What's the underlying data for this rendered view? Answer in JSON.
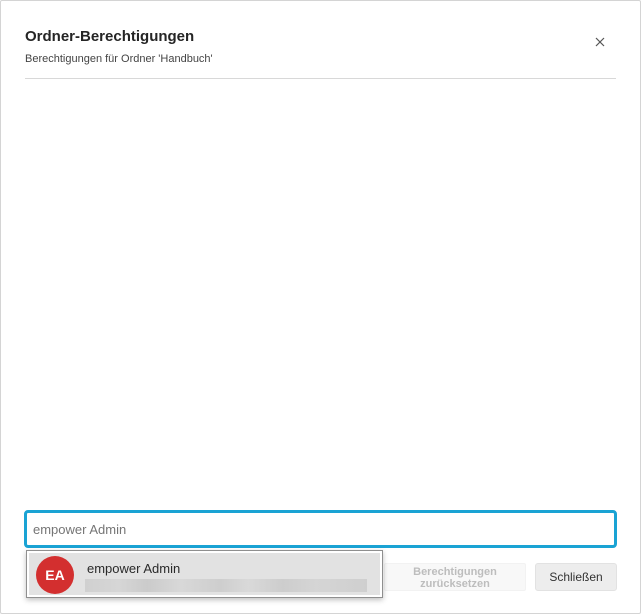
{
  "dialog": {
    "title": "Ordner-Berechtigungen",
    "subtitle": "Berechtigungen für Ordner 'Handbuch'",
    "close_icon": "close-icon"
  },
  "search": {
    "value": "",
    "placeholder": "empower Admin",
    "accent_color": "#1aa3d4"
  },
  "dropdown": {
    "options": [
      {
        "initials": "EA",
        "name": "empower Admin",
        "avatar_color": "#d32f2f"
      }
    ]
  },
  "footer": {
    "reset_label_line1": "Berechtigungen",
    "reset_label_line2": "zurücksetzen",
    "close_label": "Schließen"
  }
}
